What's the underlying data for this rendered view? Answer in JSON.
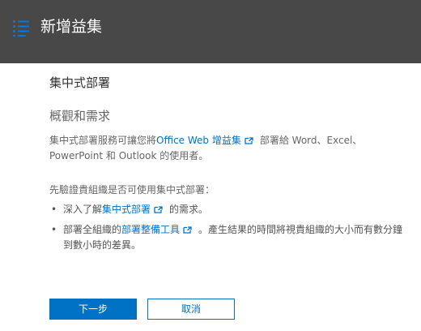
{
  "header": {
    "title": "新增益集",
    "icon": "list-icon",
    "background": "#484848"
  },
  "main": {
    "section_title": "集中式部署",
    "overview_heading": "概觀和需求",
    "intro": {
      "prefix": "集中式部署服務可讓您將",
      "link": "Office Web 增益集",
      "suffix": "部署給 Word、Excel、PowerPoint 和 Outlook 的使用者。"
    },
    "verify_text": "先驗證貴組織是否可使用集中式部署：",
    "bullets": [
      {
        "prefix": "深入了解",
        "link": "集中式部署",
        "suffix": "的需求。"
      },
      {
        "prefix": "部署全組織的",
        "link": "部署整備工具",
        "suffix": "。產生結果的時間將視貴組織的大小而有數分鐘到數小時的差異。"
      }
    ]
  },
  "buttons": {
    "next": "下一步",
    "cancel": "取消"
  },
  "colors": {
    "accent": "#0072c6",
    "text": "#666666"
  }
}
